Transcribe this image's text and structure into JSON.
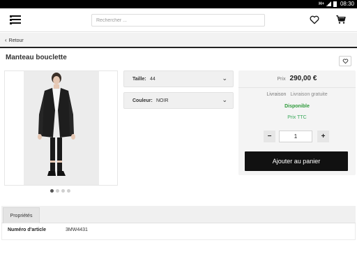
{
  "status_bar": {
    "network": "H+",
    "time": "08:30"
  },
  "header": {
    "search_placeholder": "Rechercher ...",
    "icons": [
      "menu-icon",
      "heart-icon",
      "cart-icon"
    ]
  },
  "nav": {
    "back_label": "Retour"
  },
  "product": {
    "title": "Manteau bouclette",
    "image_dots": 4,
    "active_dot": 1,
    "options": [
      {
        "label": "Taille:",
        "value": "44"
      },
      {
        "label": "Couleur:",
        "value": "NOIR"
      }
    ]
  },
  "purchase": {
    "price_label": "Prix",
    "price": "290,00 €",
    "shipping_label": "Livraison",
    "shipping_value": "Livraison gratuite",
    "availability": "Disponible",
    "tax_note": "Prix TTC",
    "quantity": "1",
    "minus_label": "−",
    "plus_label": "+",
    "add_to_cart_label": "Ajouter au panier"
  },
  "details": {
    "tab_label": "Propriétés",
    "rows": [
      {
        "label": "Numéro d'article",
        "value": "3MW4431"
      }
    ]
  },
  "colors": {
    "accent_dark": "#111111",
    "available_green": "#2e9a3a"
  }
}
